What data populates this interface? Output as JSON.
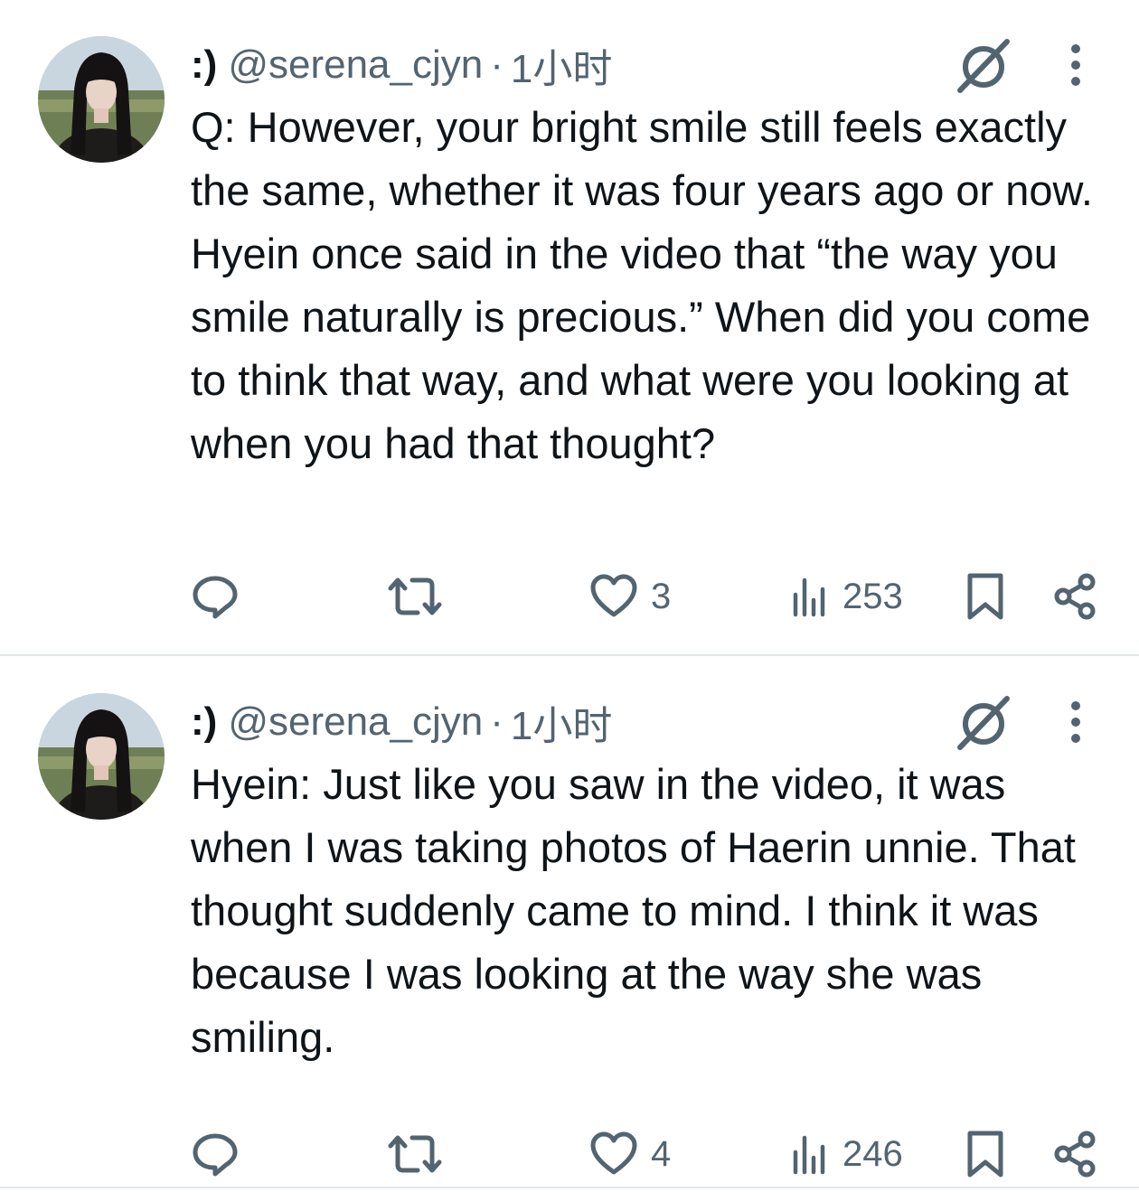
{
  "tweets": [
    {
      "display_name": ":)",
      "handle": "@serena_cjyn",
      "separator": "·",
      "time": "1小时",
      "text": "Q: However, your bright smile still feels exactly the same, whether it was four years ago or now. Hyein once said in the video that “the way you smile naturally is precious.” When did you come to think that way, and what were you looking at when you had that thought?",
      "likes": "3",
      "views": "253",
      "icons": [
        "reply-icon",
        "retweet-icon",
        "heart-icon",
        "views-icon",
        "bookmark-icon",
        "share-icon",
        "grok-icon",
        "more-icon"
      ]
    },
    {
      "display_name": ":)",
      "handle": "@serena_cjyn",
      "separator": "·",
      "time": "1小时",
      "text": "Hyein: Just like you saw in the video, it was when I was taking photos of Haerin unnie. That thought suddenly came to mind. I think it was because I was looking at the way she was smiling.",
      "likes": "4",
      "views": "246",
      "icons": [
        "reply-icon",
        "retweet-icon",
        "heart-icon",
        "views-icon",
        "bookmark-icon",
        "share-icon",
        "grok-icon",
        "more-icon"
      ]
    }
  ],
  "colors": {
    "text": "#0f1419",
    "secondary": "#536471",
    "divider": "#e1e6ea",
    "background": "#ffffff"
  }
}
